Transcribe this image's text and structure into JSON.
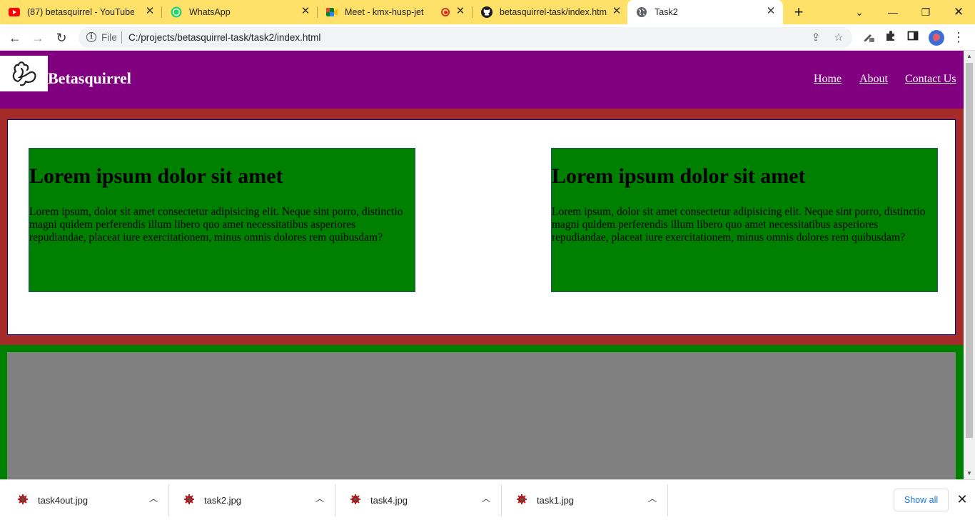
{
  "tabs": [
    {
      "title": "(87) betasquirrel - YouTube",
      "icon": "youtube-icon"
    },
    {
      "title": "WhatsApp",
      "icon": "whatsapp-icon"
    },
    {
      "title": "Meet - kmx-husp-jet",
      "icon": "google-meet-icon"
    },
    {
      "title": "betasquirrel-task/index.html",
      "icon": "github-icon"
    },
    {
      "title": "Task2",
      "icon": "globe-icon",
      "active": true
    }
  ],
  "toolbar": {
    "scheme": "File",
    "url": "C:/projects/betasquirrel-task/task2/index.html"
  },
  "site": {
    "brand": "Betasquirrel",
    "nav": [
      "Home",
      "About",
      "Contact Us"
    ],
    "cards": [
      {
        "heading": "Lorem ipsum dolor sit amet",
        "body": "Lorem ipsum, dolor sit amet consectetur adipisicing elit. Neque sint porro, distinctio magni quidem perferendis illum libero quo amet necessitatibus asperiores repudiandae, placeat iure exercitationem, minus omnis dolores rem quibusdam?"
      },
      {
        "heading": "Lorem ipsum dolor sit amet",
        "body": "Lorem ipsum, dolor sit amet consectetur adipisicing elit. Neque sint porro, distinctio magni quidem perferendis illum libero quo amet necessitatibus asperiores repudiandae, placeat iure exercitationem, minus omnis dolores rem quibusdam?"
      }
    ],
    "colors": {
      "header": "#800080",
      "section_red": "#a52a2a",
      "card": "#008000",
      "section_green": "#008000",
      "inner_gray": "#808080"
    }
  },
  "downloads": {
    "items": [
      "task4out.jpg",
      "task2.jpg",
      "task4.jpg",
      "task1.jpg"
    ],
    "show_all_label": "Show all"
  },
  "browser_colors": {
    "tabstrip": "#ffe169",
    "profile": "#3b6fd6"
  }
}
